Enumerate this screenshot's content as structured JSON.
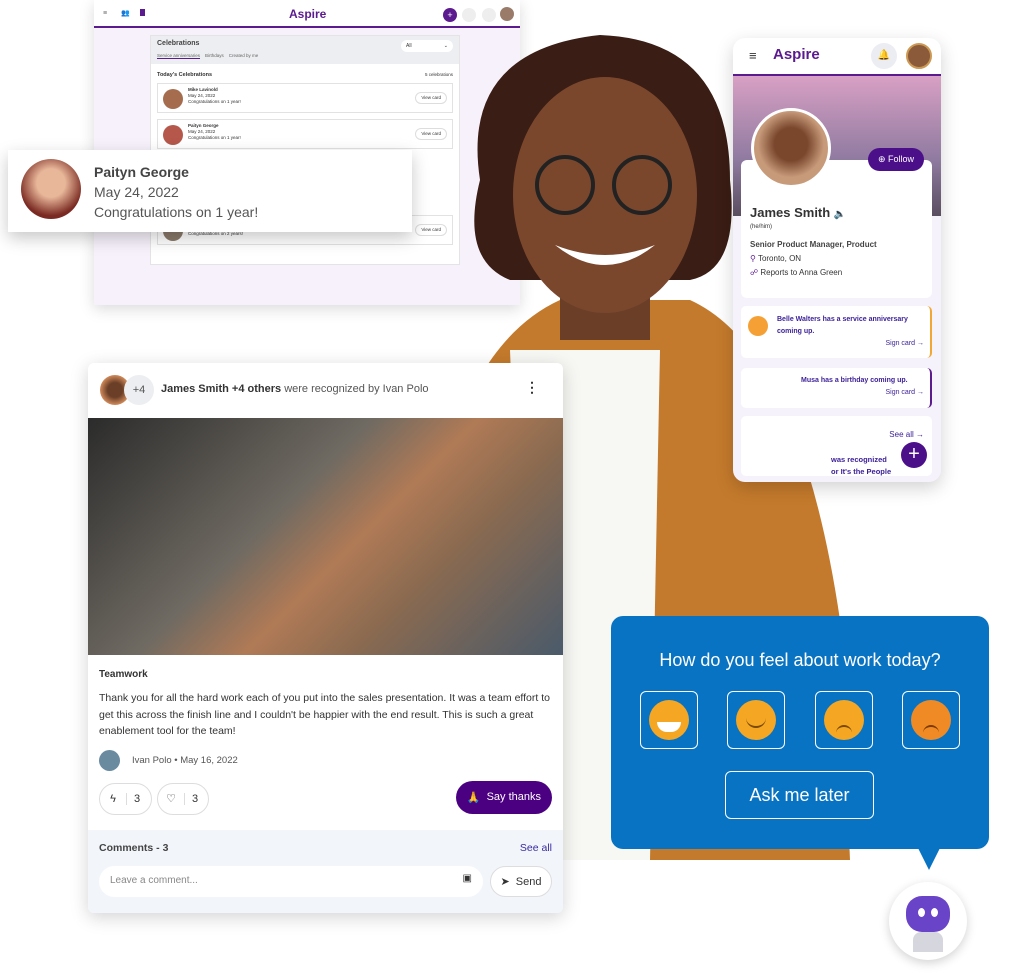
{
  "brand": {
    "name": "Aspire",
    "accent": "#5b1a8e",
    "survey_blue": "#0873c3"
  },
  "desktop": {
    "celebrations_title": "Celebrations",
    "filter_value": "All",
    "tabs": [
      "Service anniversaries",
      "Birthdays",
      "Created by me"
    ],
    "todays_title": "Today's Celebrations",
    "count": "5 celebrations",
    "rows": [
      {
        "name": "Mike Lavinold",
        "date": "May 24, 2022",
        "message": "Congratulations on 1 year!",
        "button": "View card"
      },
      {
        "name": "Paityn George",
        "date": "May 24, 2022",
        "message": "Congratulations on 1 year!",
        "button": "View card"
      },
      {
        "name": "Kaylynn Rosser",
        "date": "June 6, 2022",
        "message": "Congratulations on 2 years!",
        "button": "View card"
      }
    ]
  },
  "popup": {
    "name": "Paityn George",
    "date": "May 24, 2022",
    "message": "Congratulations on 1 year!"
  },
  "mobile": {
    "follow": "Follow",
    "name": "James Smith",
    "pronouns": "(he/him)",
    "title": "Senior Product Manager, Product",
    "location": "Toronto, ON",
    "reports_to": "Reports to Anna Green",
    "notices": [
      {
        "text": "Belle Walters has a service anniversary coming up.",
        "link": "Sign card"
      },
      {
        "text": "Musa has a birthday coming up.",
        "link": "Sign card"
      }
    ],
    "see_all": "See all",
    "feed_line1": "was recognized",
    "feed_line2": "or It's the People"
  },
  "recognition": {
    "extra_count": "+4",
    "header_bold": "James Smith +4 others",
    "header_rest": " were recognized by Ivan Polo",
    "tag": "Teamwork",
    "message": "Thank you for all the hard work each of you put into the sales presentation. It was a team effort to get this across the finish line and I couldn't be happier with the end result. This is such a great enablement tool for the team!",
    "author_line": "Ivan Polo • May 16, 2022",
    "boosts": "3",
    "likes": "3",
    "say_thanks": "Say thanks",
    "comments_label": "Comments - 3",
    "see_all": "See all",
    "comment_placeholder": "Leave a comment...",
    "send": "Send"
  },
  "survey": {
    "question": "How do you feel about work today?",
    "moods": [
      "very-happy",
      "happy",
      "sad",
      "angry"
    ],
    "later": "Ask me later"
  }
}
